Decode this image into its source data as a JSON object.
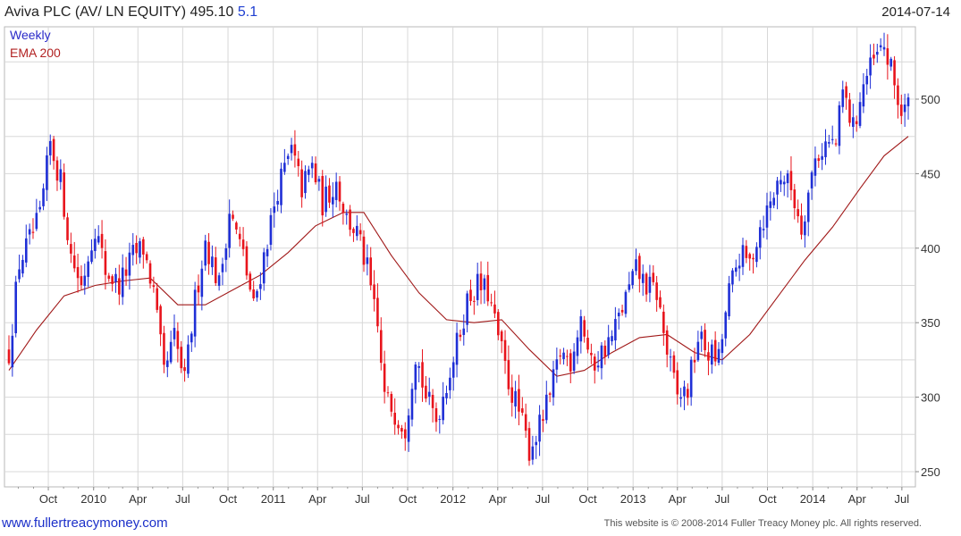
{
  "header": {
    "title": "Aviva PLC (AV/ LN EQUITY) 495.10",
    "change": "5.1",
    "date": "2014-07-14"
  },
  "legend": {
    "weekly": "Weekly",
    "ema": "EMA 200"
  },
  "footer": {
    "url": "www.fullertreacymoney.com",
    "copyright": "This website is © 2008-2014 Fuller Treacy Money plc. All rights reserved."
  },
  "colors": {
    "up": "#1f2fd6",
    "down": "#e8141c",
    "ema": "#a01818",
    "grid": "#d8d8d8"
  },
  "chart_data": {
    "type": "line",
    "description_series": "weekly candlestick bars with EMA 200 overlay",
    "ylim": [
      240,
      550
    ],
    "yticks": [
      250,
      300,
      350,
      400,
      450,
      500
    ],
    "xlabels": [
      "Oct",
      "2010",
      "Apr",
      "Jul",
      "Oct",
      "2011",
      "Apr",
      "Jul",
      "Oct",
      "2012",
      "Apr",
      "Jul",
      "Oct",
      "2013",
      "Apr",
      "Jul",
      "Oct",
      "2014",
      "Apr",
      "Jul"
    ],
    "x_start": "2009-07-13",
    "x_end": "2014-07-14",
    "series": [
      {
        "name": "Weekly",
        "close_anchors": [
          [
            "2009-07-13",
            330
          ],
          [
            "2009-08-03",
            390
          ],
          [
            "2009-08-24",
            405
          ],
          [
            "2009-09-14",
            420
          ],
          [
            "2009-10-05",
            470
          ],
          [
            "2009-10-26",
            445
          ],
          [
            "2009-11-16",
            395
          ],
          [
            "2009-12-07",
            375
          ],
          [
            "2010-01-04",
            415
          ],
          [
            "2010-01-25",
            385
          ],
          [
            "2010-02-22",
            375
          ],
          [
            "2010-03-22",
            395
          ],
          [
            "2010-04-12",
            400
          ],
          [
            "2010-05-03",
            370
          ],
          [
            "2010-05-24",
            315
          ],
          [
            "2010-06-14",
            340
          ],
          [
            "2010-07-05",
            310
          ],
          [
            "2010-07-26",
            365
          ],
          [
            "2010-08-16",
            405
          ],
          [
            "2010-09-13",
            375
          ],
          [
            "2010-10-04",
            425
          ],
          [
            "2010-11-01",
            395
          ],
          [
            "2010-11-22",
            360
          ],
          [
            "2010-12-13",
            395
          ],
          [
            "2011-01-10",
            440
          ],
          [
            "2011-02-07",
            465
          ],
          [
            "2011-02-28",
            440
          ],
          [
            "2011-03-21",
            455
          ],
          [
            "2011-04-11",
            430
          ],
          [
            "2011-05-09",
            445
          ],
          [
            "2011-05-30",
            420
          ],
          [
            "2011-06-20",
            410
          ],
          [
            "2011-07-11",
            385
          ],
          [
            "2011-08-01",
            345
          ],
          [
            "2011-08-15",
            300
          ],
          [
            "2011-09-05",
            290
          ],
          [
            "2011-09-26",
            280
          ],
          [
            "2011-10-17",
            330
          ],
          [
            "2011-11-07",
            300
          ],
          [
            "2011-11-28",
            285
          ],
          [
            "2011-12-19",
            310
          ],
          [
            "2012-01-09",
            335
          ],
          [
            "2012-01-30",
            365
          ],
          [
            "2012-02-20",
            375
          ],
          [
            "2012-03-12",
            370
          ],
          [
            "2012-04-02",
            340
          ],
          [
            "2012-04-23",
            310
          ],
          [
            "2012-05-14",
            290
          ],
          [
            "2012-06-04",
            265
          ],
          [
            "2012-06-25",
            280
          ],
          [
            "2012-07-16",
            300
          ],
          [
            "2012-08-06",
            330
          ],
          [
            "2012-08-27",
            325
          ],
          [
            "2012-09-17",
            355
          ],
          [
            "2012-10-08",
            320
          ],
          [
            "2012-10-29",
            330
          ],
          [
            "2012-11-19",
            340
          ],
          [
            "2012-12-10",
            360
          ],
          [
            "2013-01-07",
            385
          ],
          [
            "2013-01-28",
            375
          ],
          [
            "2013-02-18",
            370
          ],
          [
            "2013-03-11",
            330
          ],
          [
            "2013-04-01",
            300
          ],
          [
            "2013-04-22",
            305
          ],
          [
            "2013-05-13",
            340
          ],
          [
            "2013-06-03",
            330
          ],
          [
            "2013-06-24",
            325
          ],
          [
            "2013-07-15",
            370
          ],
          [
            "2013-08-05",
            395
          ],
          [
            "2013-08-26",
            390
          ],
          [
            "2013-09-16",
            415
          ],
          [
            "2013-10-07",
            430
          ],
          [
            "2013-10-28",
            450
          ],
          [
            "2013-11-18",
            440
          ],
          [
            "2013-12-09",
            415
          ],
          [
            "2014-01-06",
            460
          ],
          [
            "2014-01-27",
            470
          ],
          [
            "2014-02-17",
            470
          ],
          [
            "2014-03-03",
            505
          ],
          [
            "2014-03-24",
            480
          ],
          [
            "2014-04-14",
            510
          ],
          [
            "2014-05-05",
            525
          ],
          [
            "2014-05-26",
            535
          ],
          [
            "2014-06-16",
            510
          ],
          [
            "2014-06-30",
            490
          ],
          [
            "2014-07-14",
            495.1
          ]
        ]
      },
      {
        "name": "EMA 200",
        "points": [
          [
            "2009-07-13",
            318
          ],
          [
            "2009-09-07",
            345
          ],
          [
            "2009-11-02",
            368
          ],
          [
            "2010-01-04",
            375
          ],
          [
            "2010-03-01",
            378
          ],
          [
            "2010-04-26",
            380
          ],
          [
            "2010-06-21",
            362
          ],
          [
            "2010-08-16",
            362
          ],
          [
            "2010-10-11",
            372
          ],
          [
            "2010-12-06",
            382
          ],
          [
            "2011-01-31",
            397
          ],
          [
            "2011-03-28",
            415
          ],
          [
            "2011-05-23",
            424
          ],
          [
            "2011-07-04",
            424
          ],
          [
            "2011-08-29",
            395
          ],
          [
            "2011-10-24",
            370
          ],
          [
            "2011-12-19",
            352
          ],
          [
            "2012-02-13",
            350
          ],
          [
            "2012-04-09",
            352
          ],
          [
            "2012-06-04",
            332
          ],
          [
            "2012-07-30",
            314
          ],
          [
            "2012-09-24",
            318
          ],
          [
            "2012-11-19",
            330
          ],
          [
            "2013-01-14",
            340
          ],
          [
            "2013-03-11",
            342
          ],
          [
            "2013-05-06",
            330
          ],
          [
            "2013-07-01",
            325
          ],
          [
            "2013-08-26",
            342
          ],
          [
            "2013-10-21",
            367
          ],
          [
            "2013-12-16",
            392
          ],
          [
            "2014-02-10",
            414
          ],
          [
            "2014-04-07",
            440
          ],
          [
            "2014-05-26",
            462
          ],
          [
            "2014-07-14",
            475
          ]
        ]
      }
    ]
  }
}
